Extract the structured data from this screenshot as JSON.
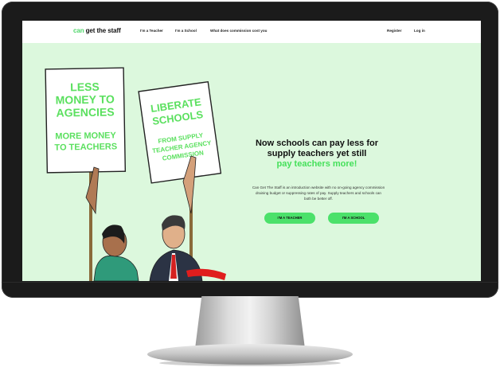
{
  "site": {
    "logo_can": "can",
    "logo_rest": " get the staff"
  },
  "nav": {
    "links": [
      "I'm a Teacher",
      "I'm a School",
      "What does commission cost you"
    ],
    "register": "Register",
    "login": "Log in"
  },
  "hero": {
    "title_line1": "Now schools can pay less for",
    "title_line2": "supply teachers yet still",
    "title_highlight": "pay teachers more!",
    "body": "Can Get The Staff is an introduction website with no on-going agency commission draining budget or suppressing rates of pay. Supply teachers and schools can both be better off.",
    "cta_teacher": "I'M A TEACHER",
    "cta_school": "I'M A SCHOOL"
  },
  "placards": {
    "left_top": [
      "LESS",
      "MONEY TO",
      "AGENCIES"
    ],
    "left_bottom": [
      "MORE MONEY",
      "TO TEACHERS"
    ],
    "right_top": [
      "LIBERATE",
      "SCHOOLS"
    ],
    "right_bottom": [
      "FROM SUPPLY",
      "TEACHER AGENCY",
      "COMMISSION"
    ]
  },
  "colors": {
    "accent_green": "#4be16a",
    "hero_background": "#dcf8dd",
    "placard_text": "#5be05f"
  }
}
